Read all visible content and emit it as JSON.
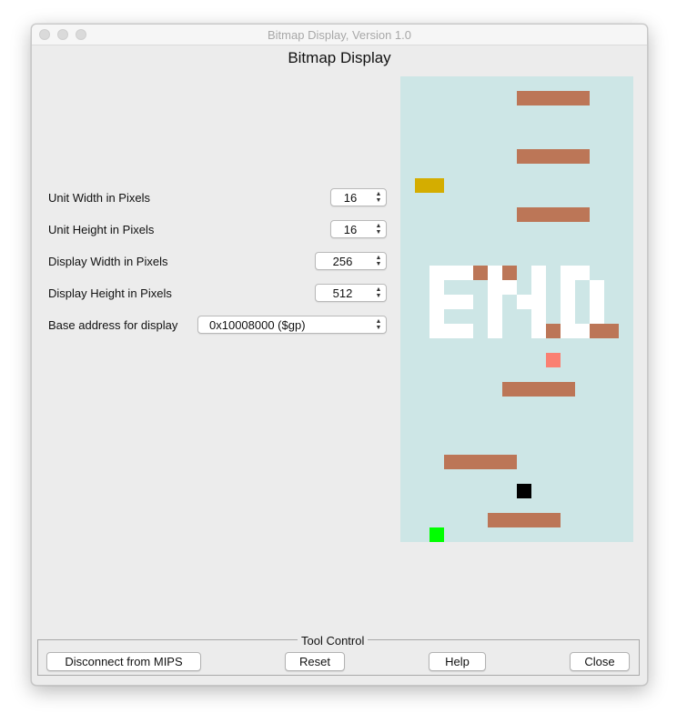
{
  "window": {
    "title": "Bitmap Display, Version 1.0"
  },
  "heading": "Bitmap Display",
  "settings": {
    "unit_width": {
      "label": "Unit Width in Pixels",
      "value": "16"
    },
    "unit_height": {
      "label": "Unit Height in Pixels",
      "value": "16"
    },
    "display_width": {
      "label": "Display Width in Pixels",
      "value": "256"
    },
    "display_height": {
      "label": "Display Height in Pixels",
      "value": "512"
    },
    "base_address": {
      "label": "Base address for display",
      "value": "0x10008000 ($gp)"
    }
  },
  "display": {
    "background": "#cde6e6",
    "colors": {
      "platform": "#bc7657",
      "white": "#ffffff",
      "yellow": "#d4ad00",
      "pink": "#fa8072",
      "black": "#000000",
      "green": "#00ff00"
    }
  },
  "tool_control": {
    "legend": "Tool Control",
    "disconnect_label": "Disconnect from MIPS",
    "reset_label": "Reset",
    "help_label": "Help",
    "close_label": "Close"
  }
}
